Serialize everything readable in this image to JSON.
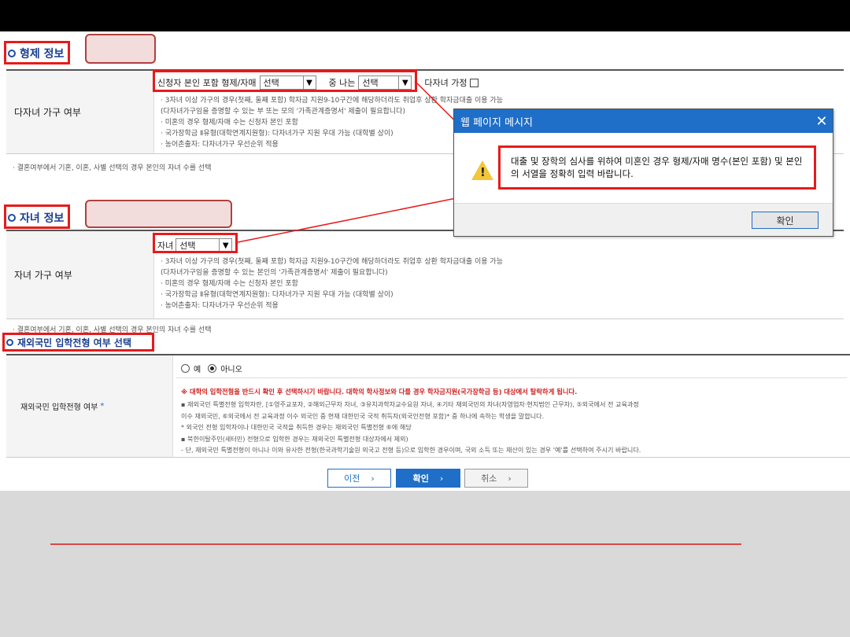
{
  "sibling_section": {
    "title": "형제 정보",
    "row_label": "다자녀 가구 여부",
    "field_label": "신청자 본인 포함 형제/자매",
    "select1_value": "선택",
    "middle_label": "중 나는",
    "select2_value": "선택",
    "multi_child_label": "다자녀 가정",
    "notes": [
      "· 3자녀 이상 가구의 경우(첫째, 둘째 포함) 학자금 지원9-10구간에 해당하더라도 취업후 상환 학자금대출 이용 가능",
      "  (다자녀가구임을 증명할 수 있는 부 또는 모의 '가족관계증명서' 제출이 필요합니다)",
      "· 미혼의 경우 형제/자매 수는 신청자 본인 포함",
      "· 국가장학금 Ⅱ유형(대학연계지원형): 다자녀가구 지원 우대 가능 (대학별 상이)",
      "· 농어촌출자: 다자녀가구 우선순위 적용"
    ],
    "footnote": "· 결혼여부에서 기혼, 이혼, 사별 선택의 경우 본인의 자녀 수를 선택"
  },
  "child_section": {
    "title": "자녀 정보",
    "row_label": "자녀 가구 여부",
    "field_label": "자녀",
    "select_value": "선택",
    "notes": [
      "· 3자녀 이상 가구의 경우(첫째, 둘째 포함) 학자금 지원9-10구간에 해당하더라도 취업후 상환 학자금대출 이용 가능",
      "  (다자녀가구임을 증명할 수 있는 본인의 '가족관계증명서' 제출이 필요합니다)",
      "· 미혼의 경우 형제/자매 수는 신청자 본인 포함",
      "· 국가장학금 Ⅱ유형(대학연계지원형): 다자녀가구 지원 우대 가능 (대학별 상이)",
      "· 농어촌출자: 다자녀가구 우선순위 적용"
    ],
    "footnote": "· 결혼여부에서 기혼, 이혼, 사별 선택의 경우 본인의 자녀 수를 선택"
  },
  "overseas_section": {
    "title": "재외국민 입학전형 여부 선택",
    "row_label": "재외국민 입학전형 여부",
    "required_mark": "*",
    "radio_yes": "예",
    "radio_no": "아니오",
    "selected": "아니오",
    "warning": "※ 대학의 입학전형을 반드시 확인 후 선택하시기 바랍니다. 대학의 학사정보와 다를 경우 학자금지원(국가장학금 등) 대상에서 탈락하게 됩니다.",
    "notes": [
      "▪ 재외국민 특별전형 입학자란, [①영주교포자, ②해외근무자 자녀, ③유치과학자교수요원 자녀, ④기타 재외국민의 자녀(자영업자·현지법인 근무자), ⑤외국에서 전 교육과정",
      "  이수 재외국민, ⑥외국에서 전 교육과정 이수 외국인 중 현재 대한민국 국적 취득자(외국인전형 포함)* 중 하나에 속하는 학생을 말합니다.",
      "  * 외국인 전형 입학자이나 대한민국 국적을 취득한 경우는 재외국민 특별전형 ⑥에 해당",
      "▪ 북한이탈주민(새터민) 전형으로 입학한 경우는 재외국민 특별전형 대상자에서 제외)",
      "- 단, 재외국민 특별전형이 아니나 이와 유사한 전형(한국과학기술원 외국고 전형 등)으로 입학한 경우이며, 국외 소득 또는 재산이 있는 경우 '예'를 선택하여 주시기 바랍니다."
    ]
  },
  "dialog": {
    "title": "웹 페이지 메시지",
    "message": "대출 및 장학의 심사를 위하여 미혼인 경우 형제/자매 명수(본인 포함) 및 본인의 서열을 정확히 입력 바랍니다.",
    "ok_label": "확인",
    "icon": "warning-icon"
  },
  "buttons": {
    "prev": "이전",
    "confirm": "확인",
    "cancel": "취소"
  },
  "colors": {
    "highlight": "#e81a1a",
    "accent": "#1f6ec7",
    "section_title": "#1a3f8f"
  }
}
